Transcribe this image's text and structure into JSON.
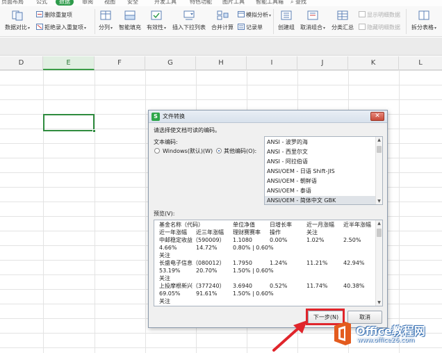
{
  "tabs": [
    {
      "label": "页面布局",
      "active": false
    },
    {
      "label": "公式",
      "active": false
    },
    {
      "label": "数据",
      "active": true
    },
    {
      "label": "审阅",
      "active": false
    },
    {
      "label": "视图",
      "active": false
    },
    {
      "label": "安全",
      "active": false
    },
    {
      "label": "开发工具",
      "active": false
    },
    {
      "label": "特色功能",
      "active": false
    },
    {
      "label": "图片工具",
      "active": false
    },
    {
      "label": "智能工具箱",
      "active": false
    }
  ],
  "search_label": "查找",
  "ribbon": {
    "data_compare": "数据对比",
    "remove_duplicates": "删除重复项",
    "reject_duplicates": "拒绝录入重复项",
    "split_column": "分列",
    "smart_fill": "智能填充",
    "validity": "有效性",
    "insert_dropdown": "插入下拉列表",
    "merge_calc": "合并计算",
    "simulate_analysis": "模拟分析",
    "record_sheet": "记录单",
    "create_group": "创建组",
    "ungroup": "取消组合",
    "subtotal": "分类汇总",
    "show_detail": "显示明细数据",
    "hide_detail": "隐藏明细数据",
    "split_table": "拆分表格"
  },
  "columns": [
    "D",
    "E",
    "F",
    "G",
    "H",
    "I",
    "J",
    "K",
    "L"
  ],
  "selected_column": "E",
  "dialog": {
    "title": "文件转换",
    "instruction": "请选择使文档可读的编码。",
    "encoding_label": "文本编码:",
    "radio_windows": "Windows(默认)(W)",
    "radio_other": "其他编码(O):",
    "encodings": [
      "ANSI - 波罗的海",
      "ANSI - 西里尔文",
      "ANSI - 阿拉伯语",
      "ANSI/OEM - 日语 Shift-JIS",
      "ANSI/OEM - 朝鲜语",
      "ANSI/OEM - 泰语",
      "ANSI/OEM - 简体中文 GBK"
    ],
    "selected_encoding_index": 6,
    "preview_label": "预览(V):",
    "preview": {
      "row1": [
        "基金名称（代码）",
        "单位净值",
        "日增长率",
        "近一月涨幅",
        "近半年涨幅"
      ],
      "row2": [
        "近一年涨幅",
        "近三年涨幅",
        "理财赛赛率",
        "操作",
        "关注"
      ],
      "row3": [
        "中邮稳定收益（590009）",
        "1.1080",
        "0.00%",
        "1.02%",
        "2.50%"
      ],
      "row4": [
        "4.66%",
        "14.72%",
        "0.80% | 0.60%"
      ],
      "row5": [
        "关注"
      ],
      "row6": [
        "长盛电子信息（080012）",
        "1.7950",
        "1.24%",
        "11.21%",
        "42.94%"
      ],
      "row7": [
        "53.19%",
        "20.70%",
        "1.50% | 0.60%"
      ],
      "row8": [
        "关注"
      ],
      "row9": [
        "上投摩根新兴（377240）",
        "3.6940",
        "0.52%",
        "11.74%",
        "40.38%"
      ],
      "row10": [
        "69.05%",
        "91.61%",
        "1.50% | 0.60%"
      ],
      "row11": [
        "关注"
      ]
    },
    "next_button": "下一步(N)",
    "cancel_button": "取消"
  },
  "watermark": {
    "name": "Office教程网",
    "url": "www.office26.com"
  },
  "colors": {
    "accent_green": "#2e9b4b",
    "highlight_red": "#e0252b",
    "watermark_blue": "#3d74b5"
  }
}
